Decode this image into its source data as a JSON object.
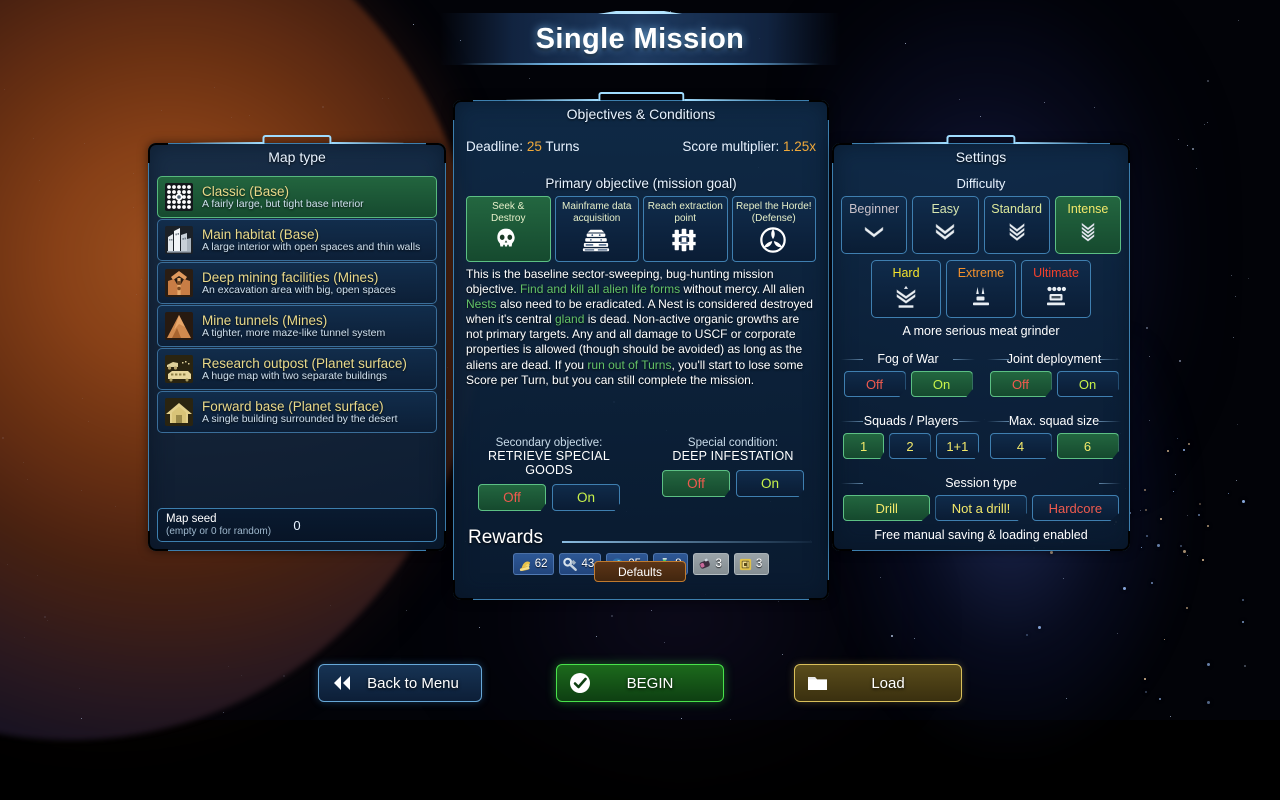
{
  "title": "Single Mission",
  "map_panel": {
    "header": "Map type",
    "items": [
      {
        "name": "Classic (Base)",
        "desc": "A fairly large, but tight base interior",
        "icon": "grid-dots-icon",
        "selected": true
      },
      {
        "name": "Main habitat (Base)",
        "desc": "A large interior with open spaces and thin walls",
        "icon": "buildings-icon",
        "selected": false
      },
      {
        "name": "Deep mining facilities (Mines)",
        "desc": "An excavation area with big, open spaces",
        "icon": "mining-rig-icon",
        "selected": false
      },
      {
        "name": "Mine tunnels (Mines)",
        "desc": "A tighter, more maze-like tunnel system",
        "icon": "mountain-icon",
        "selected": false
      },
      {
        "name": "Research outpost (Planet surface)",
        "desc": "A huge map with two separate buildings",
        "icon": "outpost-icon",
        "selected": false
      },
      {
        "name": "Forward base (Planet surface)",
        "desc": "A single building surrounded by the desert",
        "icon": "house-icon",
        "selected": false
      }
    ],
    "seed_label_1": "Map seed",
    "seed_label_2": "(empty or 0 for random)",
    "seed_value": "0"
  },
  "objectives_panel": {
    "header": "Objectives & Conditions",
    "deadline_label": "Deadline:",
    "deadline_value": "25",
    "deadline_unit": "Turns",
    "score_label": "Score multiplier:",
    "score_value": "1.25x",
    "primary_header": "Primary objective (mission goal)",
    "primary_options": [
      {
        "label": "Seek &\nDestroy",
        "line1": "Seek &",
        "line2": "Destroy",
        "icon": "skull-icon",
        "selected": true
      },
      {
        "label": "Mainframe data acquisition",
        "line1": "Mainframe data",
        "line2": "acquisition",
        "icon": "server-icon",
        "selected": false
      },
      {
        "label": "Reach extraction point",
        "line1": "Reach extraction",
        "line2": "point",
        "icon": "extraction-icon",
        "selected": false
      },
      {
        "label": "Repel the Horde! (Defense)",
        "line1": "Repel the Horde!",
        "line2": "(Defense)",
        "icon": "defense-icon",
        "selected": false
      }
    ],
    "description_parts": [
      {
        "t": "This is the baseline sector-sweeping, bug-hunting mission objective. ",
        "hl": false
      },
      {
        "t": "Find and kill all alien life forms",
        "hl": true
      },
      {
        "t": " without mercy. All alien ",
        "hl": false
      },
      {
        "t": "Nests",
        "hl": true
      },
      {
        "t": " also need to be eradicated. A Nest is considered destroyed when it's central ",
        "hl": false
      },
      {
        "t": "gland",
        "hl": true
      },
      {
        "t": " is dead. Non-active organic growths are not primary targets. Any and all damage to USCF or corporate properties is allowed (though should be avoided) as long as the aliens are dead. If you ",
        "hl": false
      },
      {
        "t": "run out of Turns",
        "hl": true
      },
      {
        "t": ", you'll start to lose some Score per Turn, but you can still complete the mission.",
        "hl": false
      }
    ],
    "secondary": {
      "title": "Secondary objective:",
      "value": "RETRIEVE SPECIAL GOODS",
      "off_label": "Off",
      "on_label": "On",
      "selected": "Off"
    },
    "special": {
      "title": "Special condition:",
      "value": "DEEP INFESTATION",
      "off_label": "Off",
      "on_label": "On",
      "selected": "Off"
    },
    "rewards_header": "Rewards",
    "rewards": [
      {
        "icon": "gold-bell-icon",
        "value": "62",
        "style": "blue"
      },
      {
        "icon": "wrench-icon",
        "value": "43",
        "style": "blue"
      },
      {
        "icon": "blue-gem-icon",
        "value": "25",
        "style": "blue"
      },
      {
        "icon": "green-flask-icon",
        "value": "8",
        "style": "blue"
      },
      {
        "icon": "grenade-icon",
        "value": "3",
        "style": "grey"
      },
      {
        "icon": "crate-icon",
        "value": "3",
        "style": "grey"
      }
    ]
  },
  "settings_panel": {
    "header": "Settings",
    "difficulty_header": "Difficulty",
    "difficulty_row1": [
      {
        "label": "Beginner",
        "chevrons": 1,
        "color_class": "c-beg",
        "selected": false
      },
      {
        "label": "Easy",
        "chevrons": 2,
        "color_class": "c-easy",
        "selected": false
      },
      {
        "label": "Standard",
        "chevrons": 3,
        "color_class": "c-std",
        "selected": false
      },
      {
        "label": "Intense",
        "chevrons": 4,
        "color_class": "c-int",
        "selected": true
      }
    ],
    "difficulty_row2": [
      {
        "label": "Hard",
        "icon": "hard-rank-icon",
        "color_class": "c-hard",
        "selected": false
      },
      {
        "label": "Extreme",
        "icon": "extreme-rank-icon",
        "color_class": "c-ext",
        "selected": false
      },
      {
        "label": "Ultimate",
        "icon": "ultimate-rank-icon",
        "color_class": "c-ult",
        "selected": false
      }
    ],
    "difficulty_note": "A more serious meat grinder",
    "fog_of_war": {
      "title": "Fog of War",
      "options": [
        "Off",
        "On"
      ],
      "selected": "On"
    },
    "joint_deployment": {
      "title": "Joint deployment",
      "options": [
        "Off",
        "On"
      ],
      "selected": "Off"
    },
    "squads_players": {
      "title": "Squads / Players",
      "options": [
        "1",
        "2",
        "1+1"
      ],
      "selected": "1"
    },
    "max_squad_size": {
      "title": "Max. squad size",
      "options": [
        "4",
        "6"
      ],
      "selected": "6"
    },
    "session_type": {
      "title": "Session type",
      "options": [
        "Drill",
        "Not a drill!",
        "Hardcore"
      ],
      "selected": "Drill"
    },
    "session_note": "Free manual saving & loading enabled",
    "defaults_label": "Defaults"
  },
  "footer": {
    "back_label": "Back to Menu",
    "back_icon": "double-arrow-left-icon",
    "begin_label": "BEGIN",
    "begin_icon": "check-circle-icon",
    "load_label": "Load",
    "load_icon": "folder-icon"
  },
  "colors": {
    "accent_blue": "#3d7fae",
    "selected_green": "#5cc084",
    "amber": "#f0a93a",
    "highlight_green": "#63c267",
    "label_yellow": "#e9d98a",
    "off_red": "#ef5a4e",
    "on_green": "#c8f24a"
  }
}
